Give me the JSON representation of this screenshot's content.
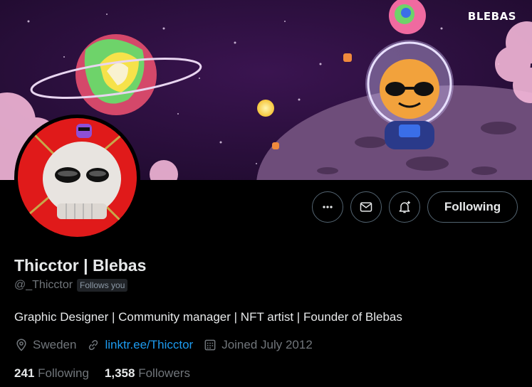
{
  "banner": {
    "logo_text": "BLEBAS",
    "image": "space-banner-with-planets-and-astronaut"
  },
  "avatar": {
    "image": "skull-character-on-red-background"
  },
  "actions": {
    "more_icon": "more-icon",
    "message_icon": "mail-icon",
    "notify_icon": "bell-plus-icon",
    "follow_label": "Following"
  },
  "profile": {
    "name": "Thicctor | Blebas",
    "handle": "@_Thicctor",
    "follows_you": "Follows you",
    "bio": "Graphic Designer | Community manager | NFT artist | Founder of Blebas",
    "location": "Sweden",
    "website": "linktr.ee/Thicctor",
    "joined": "Joined July 2012"
  },
  "stats": {
    "following_count": "241",
    "following_label": "Following",
    "followers_count": "1,358",
    "followers_label": "Followers"
  },
  "colors": {
    "background": "#000000",
    "text_primary": "#e7e9ea",
    "text_secondary": "#71767b",
    "link": "#1d9bf0",
    "border": "#536471"
  }
}
